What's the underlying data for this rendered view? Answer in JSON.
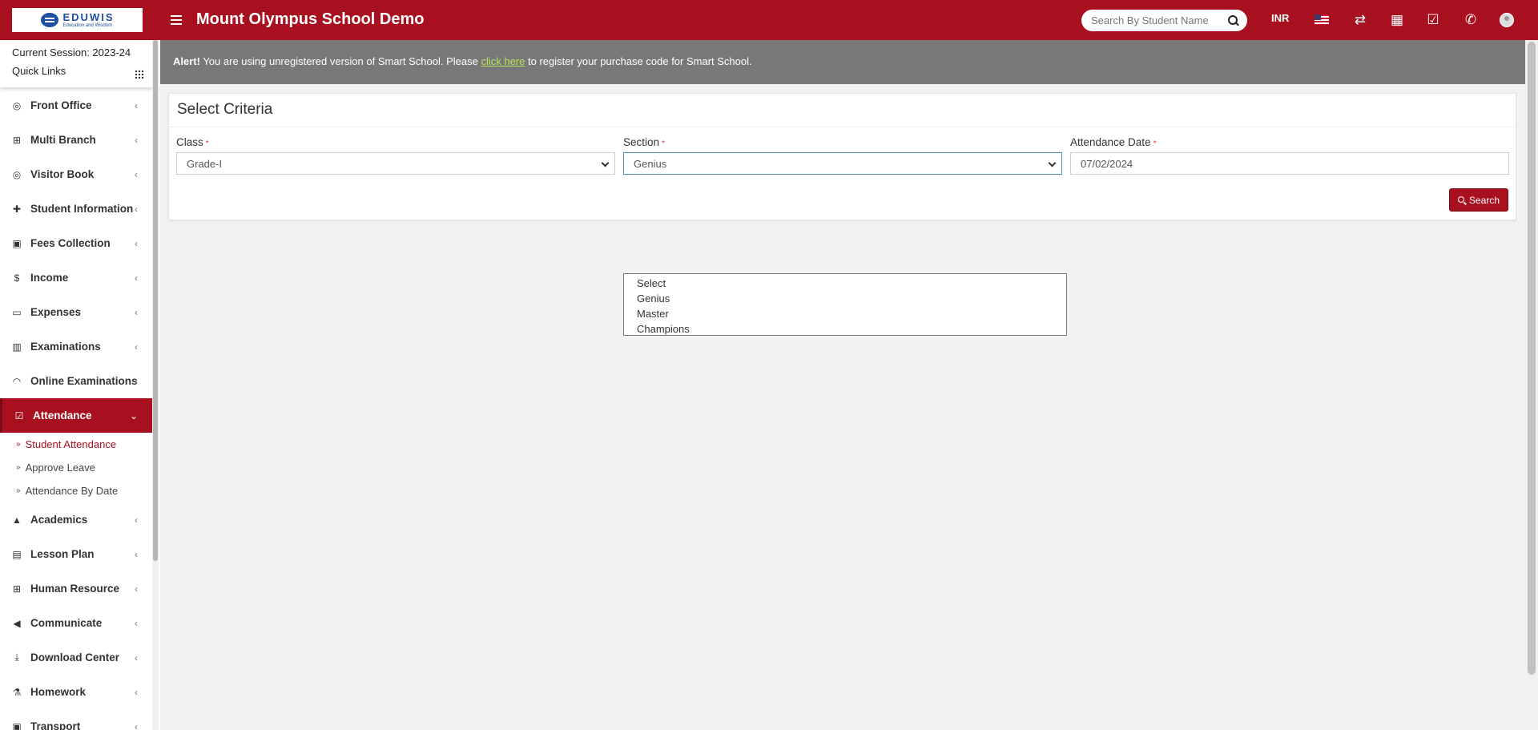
{
  "header": {
    "logo_name": "EDUWIS",
    "logo_tagline": "Education and Wisdom",
    "school_name": "Mount Olympus School Demo",
    "search_placeholder": "Search By Student Name",
    "currency": "INR",
    "accent_color": "#a8101f"
  },
  "sidebar": {
    "session": "Current Session: 2023-24",
    "quick_links": "Quick Links",
    "items": [
      {
        "label": "Front Office",
        "icon": "front-office-icon"
      },
      {
        "label": "Multi Branch",
        "icon": "sitemap-icon"
      },
      {
        "label": "Visitor Book",
        "icon": "visitor-icon"
      },
      {
        "label": "Student Information",
        "icon": "user-plus-icon"
      },
      {
        "label": "Fees Collection",
        "icon": "money-icon"
      },
      {
        "label": "Income",
        "icon": "dollar-icon"
      },
      {
        "label": "Expenses",
        "icon": "credit-card-icon"
      },
      {
        "label": "Examinations",
        "icon": "map-icon"
      },
      {
        "label": "Online Examinations",
        "icon": "rss-icon"
      },
      {
        "label": "Attendance",
        "icon": "calendar-check-icon"
      },
      {
        "label": "Academics",
        "icon": "graduation-cap-icon"
      },
      {
        "label": "Lesson Plan",
        "icon": "list-alt-icon"
      },
      {
        "label": "Human Resource",
        "icon": "sitemap-icon"
      },
      {
        "label": "Communicate",
        "icon": "bullhorn-icon"
      },
      {
        "label": "Download Center",
        "icon": "download-icon"
      },
      {
        "label": "Homework",
        "icon": "flask-icon"
      },
      {
        "label": "Transport",
        "icon": "bus-icon"
      }
    ],
    "attendance_sub": [
      {
        "label": "Student Attendance"
      },
      {
        "label": "Approve Leave"
      },
      {
        "label": "Attendance By Date"
      }
    ]
  },
  "alert": {
    "prefix": "Alert!",
    "text_before": " You are using unregistered version of Smart School. Please ",
    "link": "click here",
    "text_after": " to register your purchase code for Smart School."
  },
  "criteria": {
    "title": "Select Criteria",
    "class_label": "Class",
    "class_value": "Grade-I",
    "section_label": "Section",
    "section_value": "Genius",
    "date_label": "Attendance Date",
    "date_value": "07/02/2024",
    "required_mark": "*",
    "search_button": "Search"
  },
  "section_options": [
    "Select",
    "Genius",
    "Master",
    "Champions"
  ]
}
